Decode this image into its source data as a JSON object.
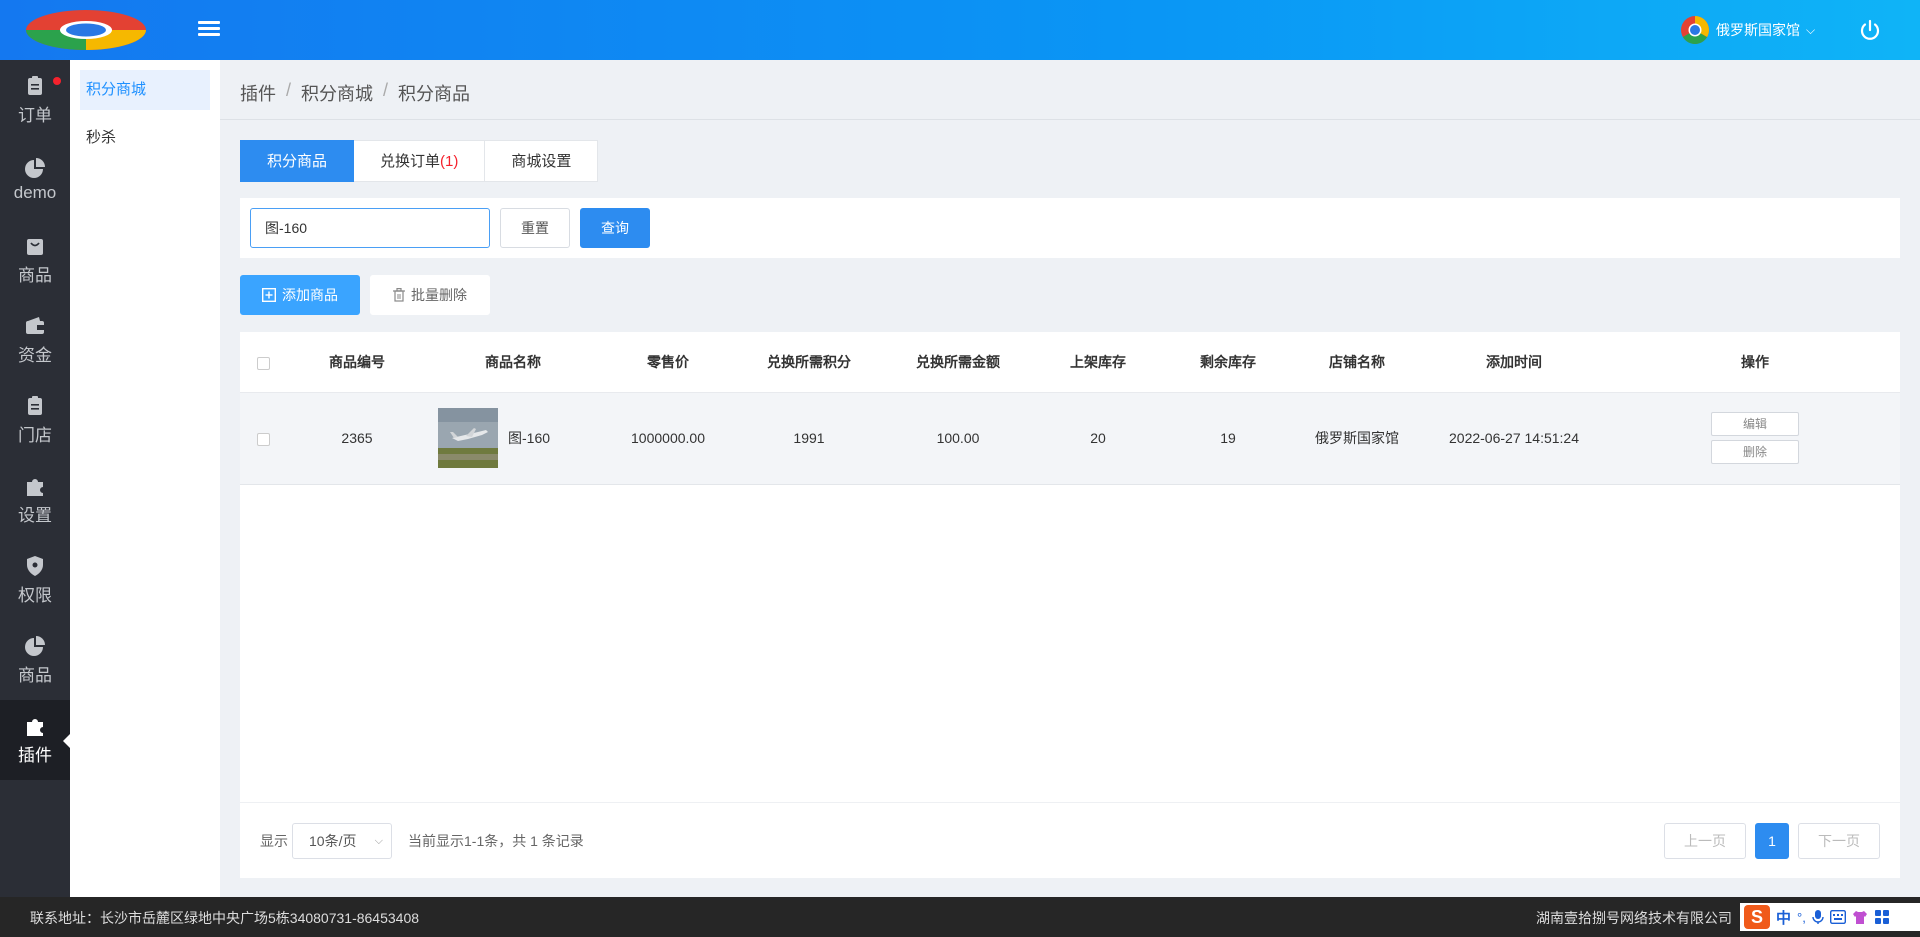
{
  "header": {
    "store_name": "俄罗斯国家馆"
  },
  "leftnav": [
    {
      "label": "订单",
      "icon": "clipboard-icon"
    },
    {
      "label": "demo",
      "icon": "pie-chart-icon"
    },
    {
      "label": "商品",
      "icon": "bag-icon"
    },
    {
      "label": "资金",
      "icon": "wallet-icon"
    },
    {
      "label": "门店",
      "icon": "clipboard-icon"
    },
    {
      "label": "设置",
      "icon": "puzzle-icon"
    },
    {
      "label": "权限",
      "icon": "shield-icon"
    },
    {
      "label": "商品",
      "icon": "pie-chart-icon"
    },
    {
      "label": "插件",
      "icon": "puzzle-icon"
    }
  ],
  "subnav": [
    "积分商城",
    "秒杀"
  ],
  "breadcrumb": [
    "插件",
    "积分商城",
    "积分商品"
  ],
  "tabs": {
    "tab1": "积分商品",
    "tab2": "兑换订单",
    "tab2_count": "(1)",
    "tab3": "商城设置"
  },
  "filter": {
    "search_value": "图-160",
    "reset_label": "重置",
    "query_label": "查询"
  },
  "actions": {
    "add_label": "添加商品",
    "batch_delete_label": "批量删除"
  },
  "table": {
    "columns": [
      "商品编号",
      "商品名称",
      "零售价",
      "兑换所需积分",
      "兑换所需金额",
      "上架库存",
      "剩余库存",
      "店铺名称",
      "添加时间",
      "操作"
    ],
    "rows": [
      {
        "id": "2365",
        "name": "图-160",
        "retail_price": "1000000.00",
        "points": "1991",
        "amount": "100.00",
        "listed_stock": "20",
        "remaining_stock": "19",
        "store": "俄罗斯国家馆",
        "added_time": "2022-06-27 14:51:24",
        "edit_label": "编辑",
        "delete_label": "删除"
      }
    ]
  },
  "pager": {
    "show_label": "显示",
    "page_size": "10条/页",
    "info": "当前显示1-1条，共 1 条记录",
    "prev_label": "上一页",
    "current_page": "1",
    "next_label": "下一页"
  },
  "footer": {
    "address": "联系地址：长沙市岳麓区绿地中央广场5栋34080731-86453408",
    "company": "湖南壹拾捌号网络技术有限公司"
  },
  "ime": {
    "logo": "S",
    "mode": "中"
  },
  "colors": {
    "primary": "#2d8cf0",
    "header_start": "#1478f0",
    "header_end": "#0fb4f7",
    "nav_bg": "#2b2e36",
    "badge_red": "#f5222d"
  }
}
